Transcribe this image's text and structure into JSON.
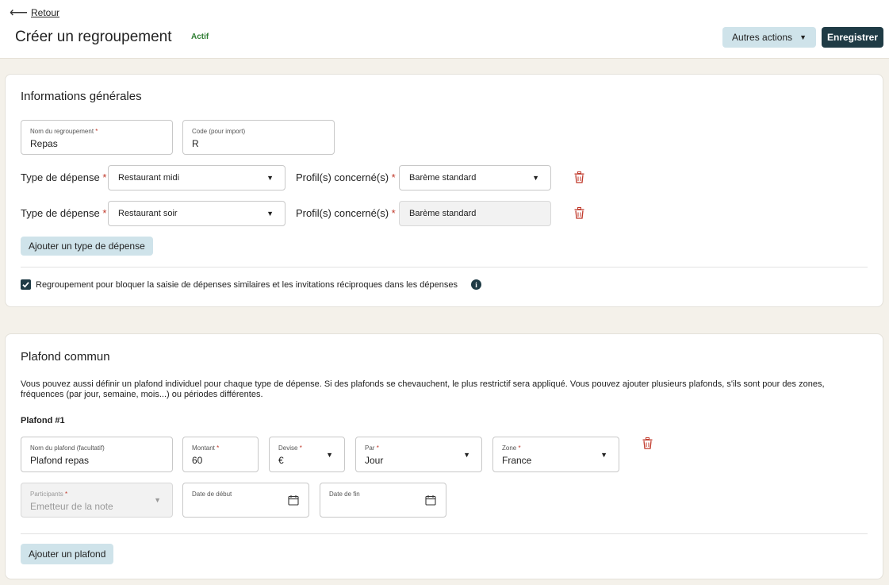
{
  "header": {
    "back_label": "Retour",
    "title": "Créer un regroupement",
    "status": "Actif",
    "more_actions_label": "Autres actions",
    "save_label": "Enregistrer"
  },
  "general": {
    "title": "Informations générales",
    "name_field": {
      "label": "Nom du regroupement",
      "value": "Repas"
    },
    "code_field": {
      "label": "Code (pour import)",
      "value": "R"
    },
    "expense_rows": [
      {
        "type_label": "Type de dépense",
        "type_value": "Restaurant midi",
        "profile_label": "Profil(s) concerné(s)",
        "profile_value": "Barème standard",
        "profile_disabled": false
      },
      {
        "type_label": "Type de dépense",
        "type_value": "Restaurant soir",
        "profile_label": "Profil(s) concerné(s)",
        "profile_value": "Barème standard",
        "profile_disabled": true
      }
    ],
    "add_type_label": "Ajouter un type de dépense",
    "block_checkbox": {
      "label": "Regroupement pour bloquer la saisie de dépenses similaires et les invitations réciproques dans les dépenses",
      "checked": true
    }
  },
  "ceiling": {
    "title": "Plafond commun",
    "description": "Vous pouvez aussi définir un plafond individuel pour chaque type de dépense. Si des plafonds se chevauchent, le plus restrictif sera appliqué. Vous pouvez ajouter plusieurs plafonds, s'ils sont pour des zones, fréquences (par jour, semaine, mois...) ou périodes différentes.",
    "item_title": "Plafond #1",
    "name": {
      "label": "Nom du plafond (facultatif)",
      "value": "Plafond repas"
    },
    "amount": {
      "label": "Montant",
      "value": "60"
    },
    "currency": {
      "label": "Devise",
      "value": "€"
    },
    "per": {
      "label": "Par",
      "value": "Jour"
    },
    "zone": {
      "label": "Zone",
      "value": "France"
    },
    "participants": {
      "label": "Participants",
      "value": "Emetteur de la note"
    },
    "start_date": {
      "label": "Date de début",
      "value": ""
    },
    "end_date": {
      "label": "Date de fin",
      "value": ""
    },
    "add_ceiling_label": "Ajouter un plafond"
  },
  "colors": {
    "accent": "#1f3b45",
    "secondary_button": "#cfe3ea",
    "required": "#c0392b",
    "status": "#2e7d32",
    "trash": "#c0392b"
  }
}
